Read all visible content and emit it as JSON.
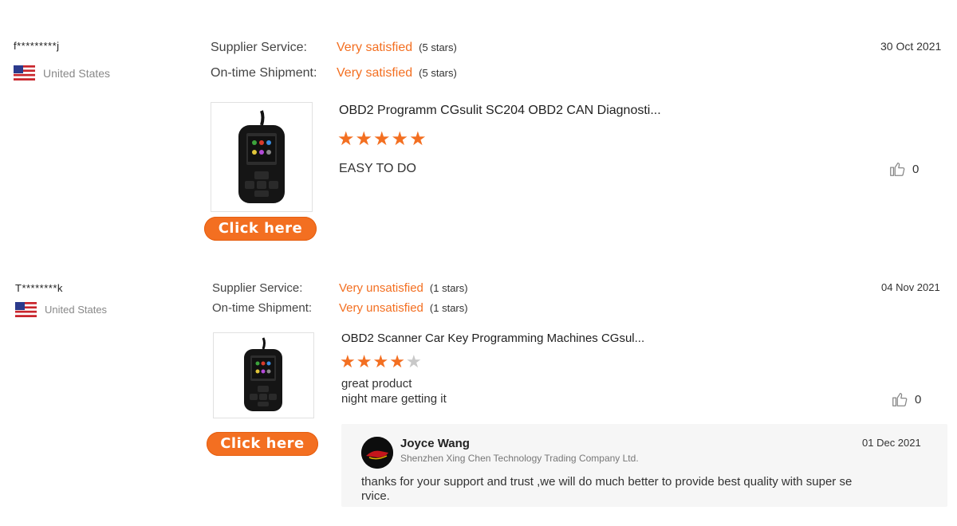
{
  "reviews": [
    {
      "username": "f*********j",
      "country": "United States",
      "supplier_service_label": "Supplier Service:",
      "supplier_service_value": "Very satisfied",
      "supplier_service_count": "(5 stars)",
      "shipment_label": "On-time Shipment:",
      "shipment_value": "Very satisfied",
      "shipment_count": "(5 stars)",
      "date": "30 Oct 2021",
      "product_title": "OBD2 Programm CGsulit SC204 OBD2 CAN Diagnosti...",
      "star_rating": 5,
      "text_line1": "EASY TO DO",
      "text_line2": "",
      "likes": "0",
      "button_label": "Click here"
    },
    {
      "username": "T********k",
      "country": "United States",
      "supplier_service_label": "Supplier Service:",
      "supplier_service_value": "Very unsatisfied",
      "supplier_service_count": "(1 stars)",
      "shipment_label": "On-time Shipment:",
      "shipment_value": "Very unsatisfied",
      "shipment_count": "(1 stars)",
      "date": "04 Nov 2021",
      "product_title": "OBD2 Scanner Car Key Programming Machines CGsul...",
      "star_rating": 4,
      "text_line1": "great product",
      "text_line2": "night mare getting it",
      "likes": "0",
      "button_label": "Click here",
      "reply": {
        "name": "Joyce Wang",
        "company": "Shenzhen Xing Chen Technology Trading Company Ltd.",
        "date": "01 Dec 2021",
        "text_line1": "thanks for your support and trust ,we will do much better  to provide best quality with super se",
        "text_line2": "rvice."
      }
    }
  ],
  "colors": {
    "accent": "#f36f21",
    "star_off": "#c8c8c8",
    "reply_bg": "#f6f6f6"
  },
  "icons": {
    "flag": "us-flag-icon",
    "like": "thumbs-up-icon",
    "star": "star-icon"
  }
}
